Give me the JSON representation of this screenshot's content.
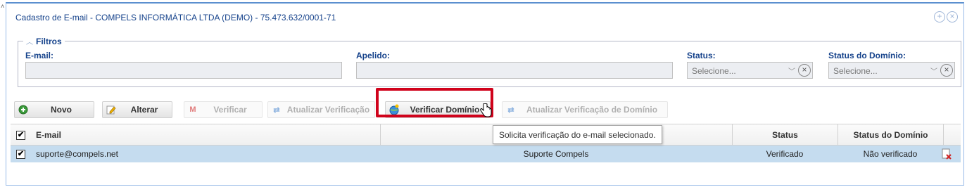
{
  "window": {
    "title": "Cadastro de E-mail - COMPELS INFORMÁTICA LTDA (DEMO) - 75.473.632/0001-71",
    "tool_icons": [
      "add-circle-icon",
      "close-circle-icon"
    ]
  },
  "filters": {
    "legend": "Filtros",
    "email_label": "E-mail:",
    "email_value": "",
    "apelido_label": "Apelido:",
    "apelido_value": "",
    "status_label": "Status:",
    "status_placeholder": "Selecione...",
    "status_dominio_label": "Status do Domínio:",
    "status_dominio_placeholder": "Selecione..."
  },
  "toolbar": {
    "novo": "Novo",
    "alterar": "Alterar",
    "verificar": "Verificar",
    "atualizar_verificacao": "Atualizar Verificação",
    "verificar_dominio": "Verificar Domínio",
    "atualizar_verificacao_dominio": "Atualizar Verificação de Domínio"
  },
  "tooltip": "Solicita verificação do e-mail selecionado.",
  "grid": {
    "columns": [
      "E-mail",
      "",
      "Status",
      "Status do Domínio"
    ],
    "rows": [
      {
        "checked": true,
        "email": "suporte@compels.net",
        "apelido": "Suporte Compels",
        "status": "Verificado",
        "status_dominio": "Não verificado"
      }
    ]
  },
  "colors": {
    "title": "#15428b",
    "selected_row": "#c5dcef",
    "highlight": "#d0021b"
  }
}
